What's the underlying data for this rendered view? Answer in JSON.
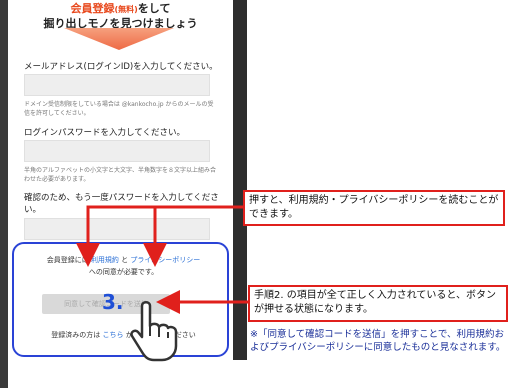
{
  "banner": {
    "line1_highlight": "会員登録",
    "line1_small": "(無料)",
    "line1_rest": "をして",
    "line2": "掘り出しモノを見つけましょう"
  },
  "form": {
    "email_label": "メールアドレス(ログインID)を入力してください。",
    "email_note": "ドメイン受信制限をしている場合は @kankocho.jp からのメールの受信を許可してください。",
    "password_label": "ログインパスワードを入力してください。",
    "password_note": "半角のアルファベットの小文字と大文字、半角数字を８文字以上組み合わせた必要があります。",
    "confirm_label": "確認のため、もう一度パスワードを入力してください。"
  },
  "consent": {
    "prefix": "会員登録には",
    "terms_link": "利用規約",
    "and": "と",
    "privacy_link": "プライバシーポリシー",
    "suffix": "への同意が必要です。",
    "submit_label": "同意して確認コードを送信",
    "step_number": "3.",
    "login_prefix": "登録済みの方は",
    "login_link": "こちら",
    "login_suffix": "からログインください"
  },
  "callouts": {
    "top": "押すと、利用規約・プライバシーポリシーを読むことができます。",
    "bottom": "手順2. の項目が全て正しく入力されていると、ボタンが押せる状態になります。",
    "footnote": "※「同意して確認コードを送信」を押すことで、利用規約およびプライバシーポリシーに同意したものと見なされます。"
  },
  "colors": {
    "callout_border": "#e0201c",
    "consent_border": "#2a43d6",
    "footnote_text": "#1a2f99",
    "accent": "#e8481c"
  }
}
